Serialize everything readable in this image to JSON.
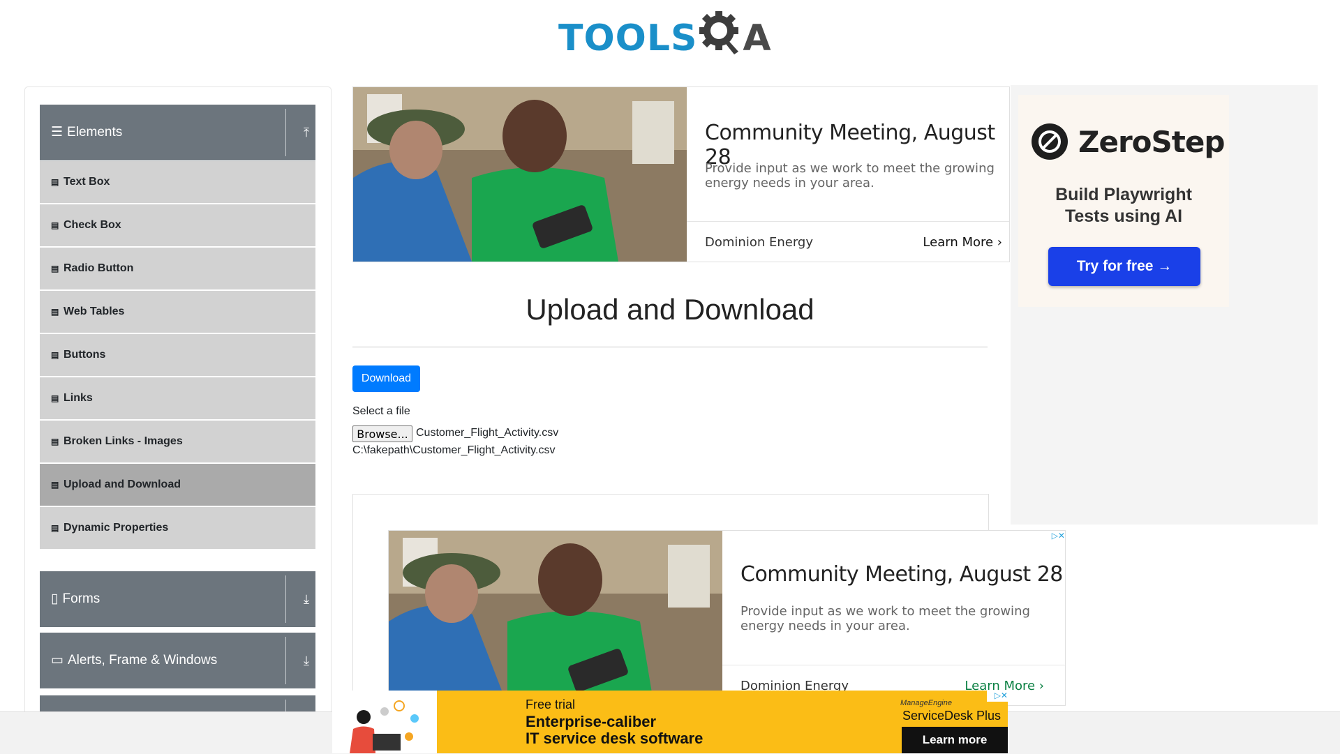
{
  "header": {
    "logo_primary": "TOOLS",
    "logo_secondary": "QA"
  },
  "sidebar": {
    "elements_group": {
      "label": "Elements",
      "arrow": "⤒"
    },
    "items": [
      {
        "label": "Text Box"
      },
      {
        "label": "Check Box"
      },
      {
        "label": "Radio Button"
      },
      {
        "label": "Web Tables"
      },
      {
        "label": "Buttons"
      },
      {
        "label": "Links"
      },
      {
        "label": "Broken Links - Images"
      },
      {
        "label": "Upload and Download",
        "active": true
      },
      {
        "label": "Dynamic Properties"
      }
    ],
    "forms_group": {
      "label": "Forms",
      "arrow": "⤓"
    },
    "alerts_group": {
      "label": "Alerts, Frame & Windows",
      "arrow": "⤓"
    }
  },
  "top_ad": {
    "headline": "Community Meeting, August 28",
    "body": "Provide input as we work to meet the growing energy needs in your area.",
    "advertiser": "Dominion Energy",
    "cta": "Learn More ›"
  },
  "main": {
    "title": "Upload and Download",
    "download_label": "Download",
    "select_label": "Select a file",
    "browse_label": "Browse...",
    "file_name": "Customer_Flight_Activity.csv",
    "file_path": "C:\\fakepath\\Customer_Flight_Activity.csv"
  },
  "mid_ad": {
    "headline": "Community Meeting, August 28",
    "body": "Provide input as we work to meet the growing energy needs in your area.",
    "advertiser": "Dominion Energy",
    "cta": "Learn More ›",
    "close": "▷✕"
  },
  "right_ad": {
    "brand": "ZeroStep",
    "tagline_1": "Build Playwright",
    "tagline_2": "Tests using AI",
    "cta": "Try for free →"
  },
  "bottom_ad": {
    "kicker": "Free trial",
    "line1": "Enterprise-caliber",
    "line2": "IT service desk software",
    "brand_small": "ManageEngine",
    "brand": "ServiceDesk Plus",
    "cta": "Learn more",
    "close": "▷✕"
  },
  "colors": {
    "primary": "#007bff",
    "sidebar_group": "#6c757d",
    "sidebar_item": "#d2d2d2",
    "sidebar_active": "#aaaaaa",
    "logo_blue": "#1a8fc9",
    "banner_yellow": "#fbbd16",
    "zerostep_button": "#1a40e8"
  }
}
